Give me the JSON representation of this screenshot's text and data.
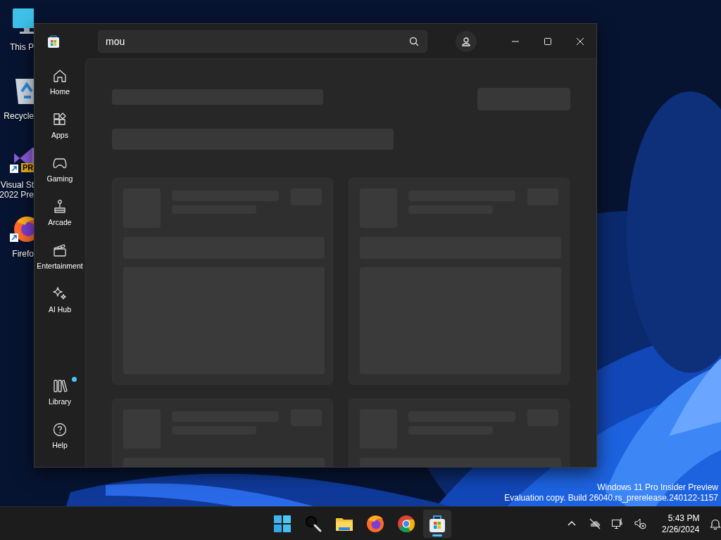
{
  "desktop_icons": [
    {
      "kind": "monitor",
      "lines": [
        "This P"
      ],
      "shortcut": false
    },
    {
      "kind": "recycle-bin",
      "lines": [
        "Recycle"
      ],
      "shortcut": false
    },
    {
      "kind": "visual-studio",
      "lines": [
        "Visual St",
        "2022 Pre"
      ],
      "shortcut": true,
      "badge": "PR"
    },
    {
      "kind": "firefox",
      "lines": [
        "Firefo"
      ],
      "shortcut": true
    }
  ],
  "window": {
    "search": {
      "value": "mou"
    },
    "nav": [
      {
        "kind": "home",
        "label": "Home",
        "selected": false,
        "notification": false
      },
      {
        "kind": "apps",
        "label": "Apps",
        "selected": false,
        "notification": false
      },
      {
        "kind": "gaming",
        "label": "Gaming",
        "selected": false,
        "notification": false
      },
      {
        "kind": "arcade",
        "label": "Arcade",
        "selected": false,
        "notification": false
      },
      {
        "kind": "entertainment",
        "label": "Entertainment",
        "selected": false,
        "notification": false
      },
      {
        "kind": "ai",
        "label": "AI Hub",
        "selected": false,
        "notification": false
      }
    ],
    "nav_bottom": [
      {
        "kind": "library",
        "label": "Library",
        "selected": false,
        "notification": true
      },
      {
        "kind": "help",
        "label": "Help",
        "selected": false,
        "notification": false
      }
    ],
    "content": {
      "loading": true
    }
  },
  "watermark_lines": [
    "Windows 11 Pro Insider Preview",
    "Evaluation copy. Build 26040.rs_prerelease.240122-1157"
  ],
  "taskbar": {
    "apps": [
      {
        "kind": "start",
        "selected": false
      },
      {
        "kind": "search",
        "selected": false
      },
      {
        "kind": "explorer",
        "selected": false
      },
      {
        "kind": "firefox",
        "selected": false
      },
      {
        "kind": "chrome",
        "selected": false
      },
      {
        "kind": "store",
        "selected": true
      }
    ],
    "tray": [
      {
        "kind": "chevron"
      },
      {
        "kind": "cloud-off"
      },
      {
        "kind": "network"
      },
      {
        "kind": "volume-muted"
      }
    ],
    "time": "5:43 PM",
    "date": "2/26/2024"
  }
}
